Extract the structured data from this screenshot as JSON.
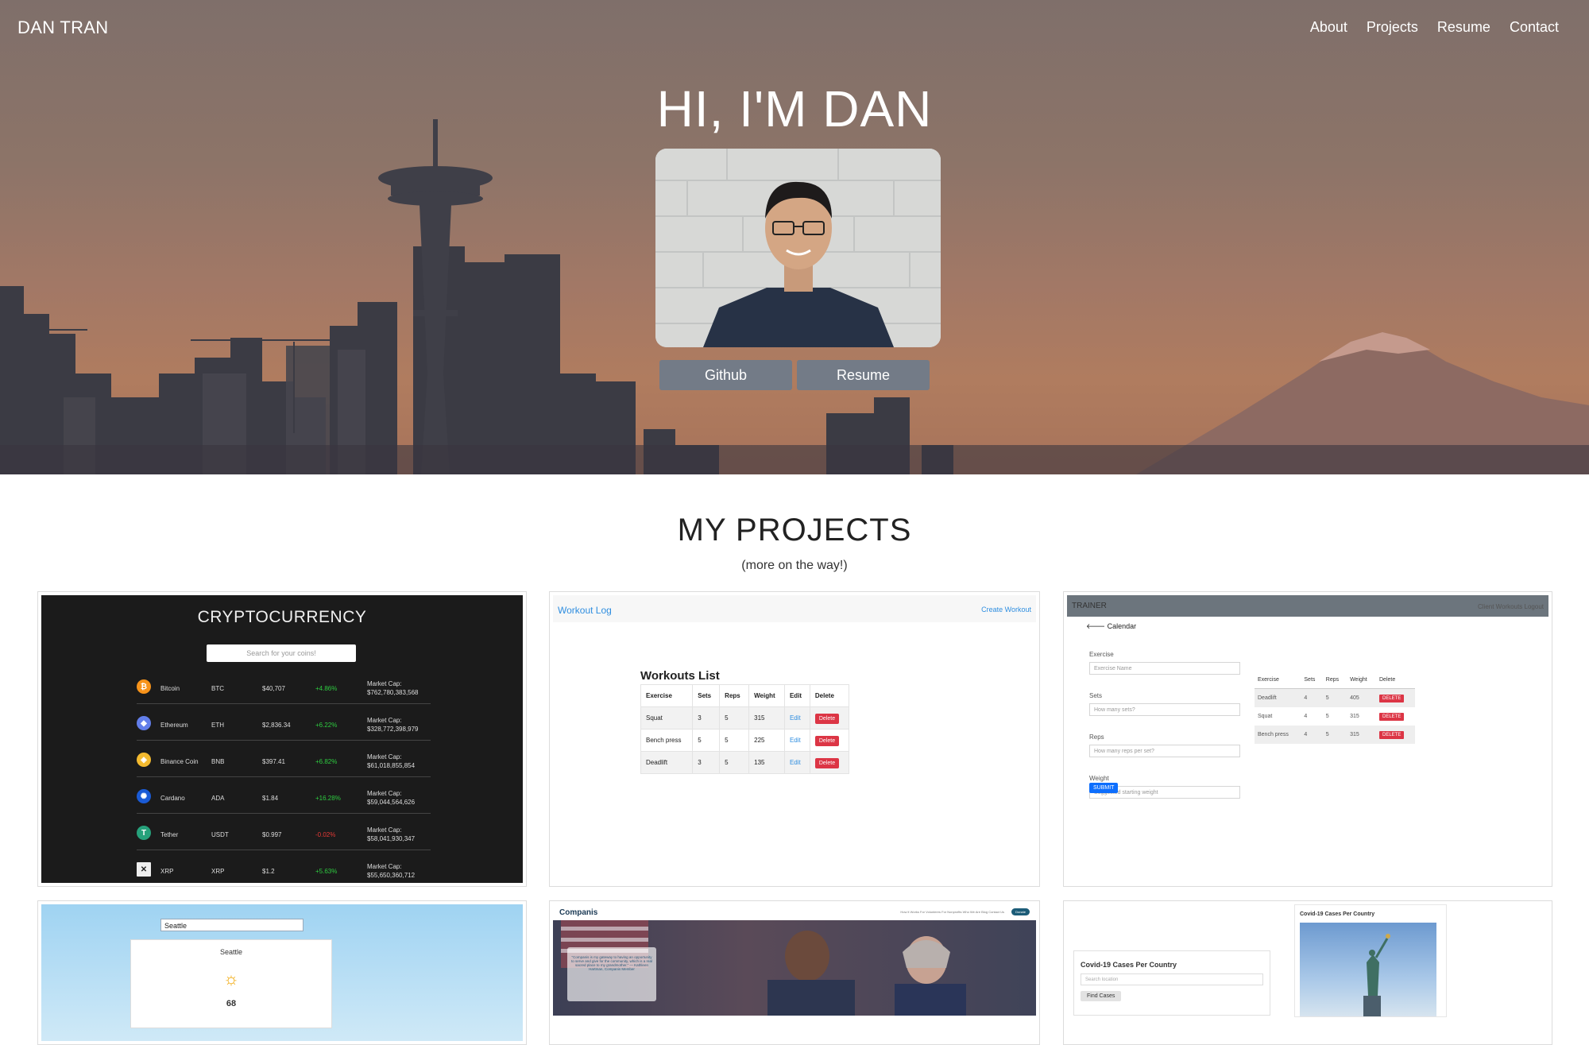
{
  "nav": {
    "brand": "DAN TRAN",
    "links": [
      "About",
      "Projects",
      "Resume",
      "Contact"
    ]
  },
  "hero": {
    "title": "HI, I'M DAN",
    "buttons": {
      "github": "Github",
      "resume": "Resume"
    }
  },
  "projects": {
    "title": "MY PROJECTS",
    "subtitle": "(more on the way!)",
    "crypto": {
      "title": "CRYPTOCURRENCY",
      "search_placeholder": "Search for your coins!",
      "rows": [
        {
          "name": "Bitcoin",
          "symbol": "BTC",
          "price": "$40,707",
          "change": "+4.86%",
          "cap_label": "Market Cap:",
          "cap": "$762,780,383,568",
          "color": "#f7931a",
          "glyph": "₿"
        },
        {
          "name": "Ethereum",
          "symbol": "ETH",
          "price": "$2,836.34",
          "change": "+6.22%",
          "cap_label": "Market Cap:",
          "cap": "$328,772,398,979",
          "color": "#627eea",
          "glyph": "◆"
        },
        {
          "name": "Binance Coin",
          "symbol": "BNB",
          "price": "$397.41",
          "change": "+6.82%",
          "cap_label": "Market Cap:",
          "cap": "$61,018,855,854",
          "color": "#f3ba2f",
          "glyph": "◈"
        },
        {
          "name": "Cardano",
          "symbol": "ADA",
          "price": "$1.84",
          "change": "+16.28%",
          "cap_label": "Market Cap:",
          "cap": "$59,044,564,626",
          "color": "#1a5bd6",
          "glyph": "✺"
        },
        {
          "name": "Tether",
          "symbol": "USDT",
          "price": "$0.997",
          "change": "-0.02%",
          "cap_label": "Market Cap:",
          "cap": "$58,041,930,347",
          "color": "#26a17b",
          "glyph": "T"
        },
        {
          "name": "XRP",
          "symbol": "XRP",
          "price": "$1.2",
          "change": "+5.63%",
          "cap_label": "Market Cap:",
          "cap": "$55,650,360,712",
          "color": "#eeeeee",
          "glyph": "✕"
        }
      ]
    },
    "workout": {
      "logo": "Workout Log",
      "create": "Create Workout",
      "list_title": "Workouts List",
      "headers": [
        "Exercise",
        "Sets",
        "Reps",
        "Weight",
        "Edit",
        "Delete"
      ],
      "rows": [
        {
          "exercise": "Squat",
          "sets": "3",
          "reps": "5",
          "weight": "315",
          "edit": "Edit",
          "delete": "Delete"
        },
        {
          "exercise": "Bench press",
          "sets": "5",
          "reps": "5",
          "weight": "225",
          "edit": "Edit",
          "delete": "Delete"
        },
        {
          "exercise": "Deadlift",
          "sets": "3",
          "reps": "5",
          "weight": "135",
          "edit": "Edit",
          "delete": "Delete"
        }
      ]
    },
    "trainer": {
      "brand": "TRAINER",
      "menu": "Client Workouts   Logout",
      "back": "Calendar",
      "fields": [
        {
          "label": "Exercise",
          "placeholder": "Exercise Name"
        },
        {
          "label": "Sets",
          "placeholder": "How many sets?"
        },
        {
          "label": "Reps",
          "placeholder": "How many reps per set?"
        },
        {
          "label": "Weight",
          "placeholder": "Suggested starting weight"
        }
      ],
      "submit": "SUBMIT",
      "headers": [
        "Exercise",
        "Sets",
        "Reps",
        "Weight",
        "Delete"
      ],
      "rows": [
        {
          "exercise": "Deadlift",
          "sets": "4",
          "reps": "5",
          "weight": "405",
          "delete": "DELETE"
        },
        {
          "exercise": "Squat",
          "sets": "4",
          "reps": "5",
          "weight": "315",
          "delete": "DELETE"
        },
        {
          "exercise": "Bench press",
          "sets": "4",
          "reps": "5",
          "weight": "315",
          "delete": "DELETE"
        }
      ]
    },
    "weather": {
      "search_value": "Seattle",
      "city": "Seattle",
      "temp": "68"
    },
    "companis": {
      "logo": "Companis",
      "menu": "How it Works   For Volunteers   For Nonprofits   Who We Are   Blog   Contact Us",
      "donate": "Donate",
      "quote": "\"Companis is my gateway to having an opportunity to serve and give for the community, which is a real sacred place to my grandmother.\" — Kathleen Hartman, Companis Member"
    },
    "covid": {
      "panel_title": "Covid-19 Cases Per Country",
      "search_placeholder": "Search location",
      "button": "Find Cases",
      "side_title": "Covid-19 Cases Per Country"
    }
  }
}
